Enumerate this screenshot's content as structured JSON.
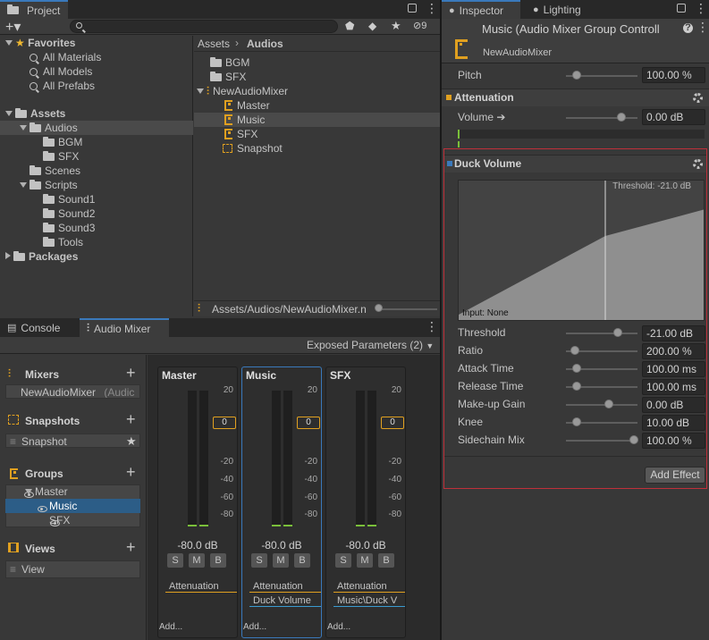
{
  "project_panel": {
    "tab_label": "Project",
    "tree": {
      "favorites": "Favorites",
      "favorite_items": [
        "All Materials",
        "All Models",
        "All Prefabs"
      ],
      "assets": "Assets",
      "audios": "Audios",
      "audio_children": [
        "BGM",
        "SFX"
      ],
      "scenes": "Scenes",
      "scripts": "Scripts",
      "script_children": [
        "Sound1",
        "Sound2",
        "Sound3",
        "Tools"
      ],
      "packages": "Packages"
    },
    "breadcrumb": [
      "Assets",
      "Audios"
    ],
    "files": {
      "bgm": "BGM",
      "sfx": "SFX",
      "mixer": "NewAudioMixer",
      "groups": [
        "Master",
        "Music",
        "SFX"
      ],
      "snapshot": "Snapshot"
    },
    "path": "Assets/Audios/NewAudioMixer.n",
    "hidden_count": "9"
  },
  "bottom_tabs": {
    "console": "Console",
    "audio_mixer": "Audio Mixer"
  },
  "exposed_params": "Exposed Parameters (2)",
  "mixer_sidebar": {
    "mixers_label": "Mixers",
    "mixer_name": "NewAudioMixer",
    "mixer_suffix": "(Audic",
    "snapshots_label": "Snapshots",
    "snapshot_name": "Snapshot",
    "groups_label": "Groups",
    "groups": [
      "Master",
      "Music",
      "SFX"
    ],
    "views_label": "Views",
    "view_name": "View"
  },
  "strips": [
    {
      "name": "Master",
      "db": "-80.0 dB",
      "effects": [
        "Attenuation"
      ],
      "add": "Add..."
    },
    {
      "name": "Music",
      "db": "-80.0 dB",
      "effects": [
        "Attenuation",
        "Duck Volume"
      ],
      "add": "Add..."
    },
    {
      "name": "SFX",
      "db": "-80.0 dB",
      "effects": [
        "Attenuation",
        "Music\\Duck V"
      ],
      "add": "Add..."
    }
  ],
  "scale_labels": [
    "20",
    "0",
    "-20",
    "-40",
    "-60",
    "-80"
  ],
  "attenuation_marker": "0",
  "smb": [
    "S",
    "M",
    "B"
  ],
  "inspector": {
    "tab_inspector": "Inspector",
    "tab_lighting": "Lighting",
    "title": "Music (Audio Mixer Group Controll",
    "subtitle": "NewAudioMixer",
    "pitch_label": "Pitch",
    "pitch_value": "100.00 %",
    "attenuation_header": "Attenuation",
    "volume_label": "Volume ➔",
    "volume_value": "0.00 dB",
    "duck_header": "Duck Volume",
    "threshold_overlay": "Threshold: -21.0 dB",
    "input_overlay": "Input: None",
    "params": [
      {
        "label": "Threshold",
        "value": "-21.00 dB",
        "level": 0.72
      },
      {
        "label": "Ratio",
        "value": "200.00 %",
        "level": 0.12
      },
      {
        "label": "Attack Time",
        "value": "100.00 ms",
        "level": 0.15
      },
      {
        "label": "Release Time",
        "value": "100.00 ms",
        "level": 0.15
      },
      {
        "label": "Make-up Gain",
        "value": "0.00 dB",
        "level": 0.6
      },
      {
        "label": "Knee",
        "value": "10.00 dB",
        "level": 0.15
      },
      {
        "label": "Sidechain Mix",
        "value": "100.00 %",
        "level": 0.95
      }
    ],
    "add_effect": "Add Effect"
  },
  "colors": {
    "accent_blue": "#3a79bb",
    "group_orange": "#e0a020",
    "selection": "#2c5d87",
    "highlight_border": "#c0303a"
  }
}
